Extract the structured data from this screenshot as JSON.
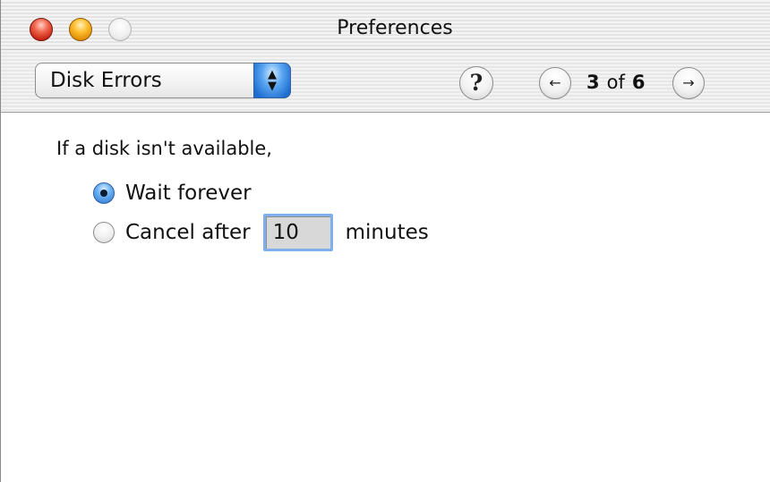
{
  "window": {
    "title": "Preferences",
    "traffic_lights": [
      "close",
      "minimize",
      "zoom"
    ]
  },
  "toolbar": {
    "section_popup": {
      "selected": "Disk Errors"
    },
    "help_label": "?",
    "prev_label": "←",
    "next_label": "→",
    "pager": {
      "current": "3",
      "of": "of",
      "total": "6"
    }
  },
  "content": {
    "prompt": "If a disk isn't available,",
    "options": [
      {
        "label": "Wait forever",
        "selected": true
      },
      {
        "label": "Cancel after",
        "selected": false
      }
    ],
    "timeout": {
      "value": "10",
      "unit": "minutes"
    }
  }
}
